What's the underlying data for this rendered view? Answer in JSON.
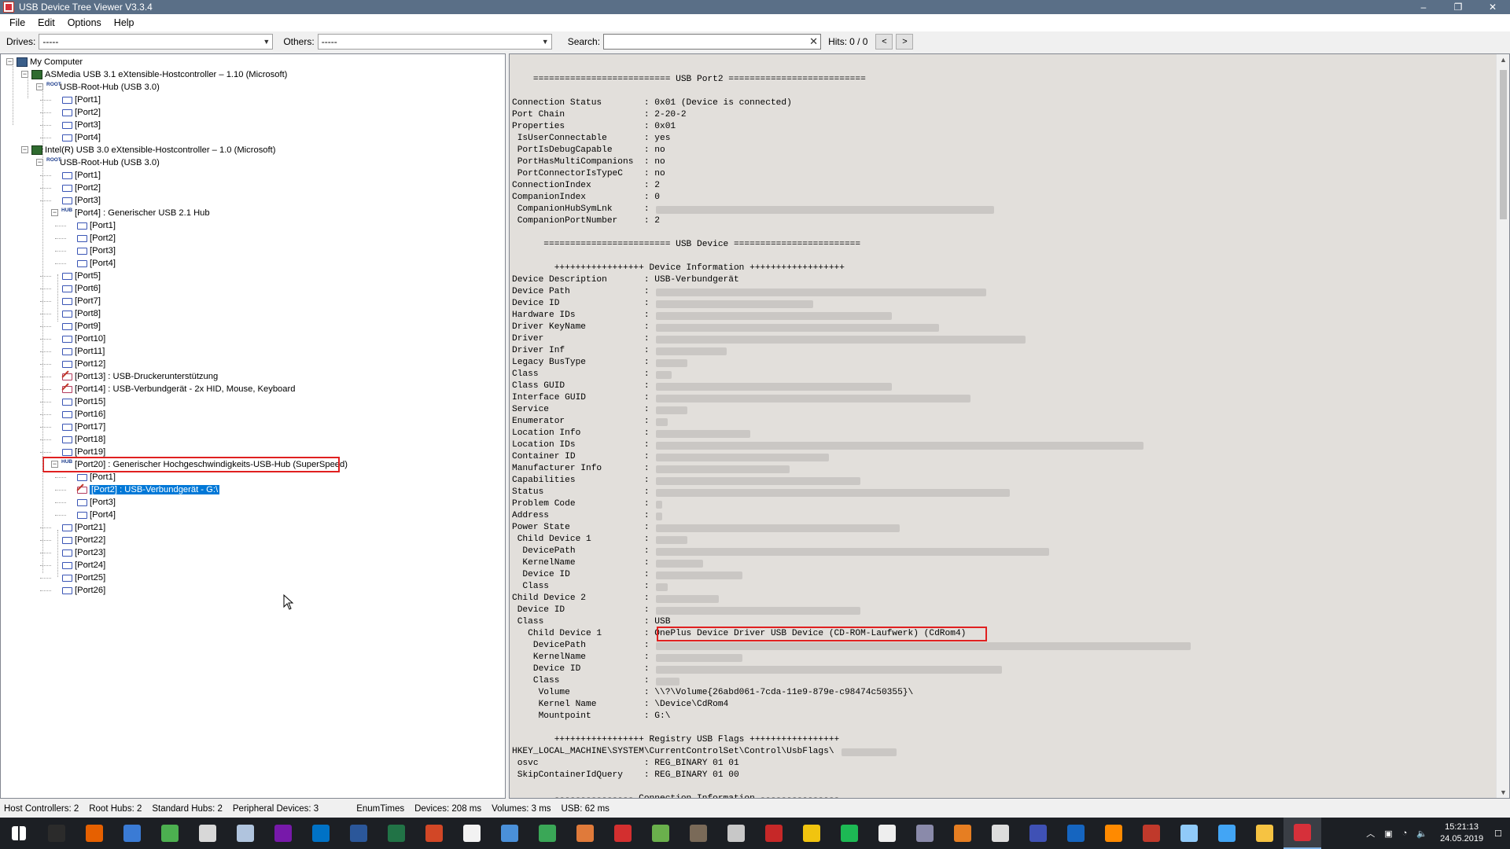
{
  "window": {
    "title": "USB Device Tree Viewer V3.3.4",
    "min": "–",
    "max": "❐",
    "close": "✕"
  },
  "menu": [
    "File",
    "Edit",
    "Options",
    "Help"
  ],
  "toolbar": {
    "drives_label": "Drives:",
    "drives_value": "-----",
    "others_label": "Others:",
    "others_value": "-----",
    "search_label": "Search:",
    "search_value": "",
    "hits_label": "Hits:",
    "hits_value": "0 / 0",
    "prev": "<",
    "next": ">"
  },
  "tree": [
    {
      "label": "My Computer",
      "level": 0,
      "icon": "computer-icon",
      "exp": "minus"
    },
    {
      "label": "ASMedia USB 3.1 eXtensible-Hostcontroller – 1.10 (Microsoft)",
      "level": 1,
      "icon": "controller-icon",
      "exp": "minus"
    },
    {
      "label": "USB-Root-Hub (USB 3.0)",
      "level": 2,
      "icon": "root-hub-icon",
      "exp": "minus"
    },
    {
      "label": "[Port1]",
      "level": 3,
      "icon": "usb-port-icon"
    },
    {
      "label": "[Port2]",
      "level": 3,
      "icon": "usb-port-icon"
    },
    {
      "label": "[Port3]",
      "level": 3,
      "icon": "usb-port-icon"
    },
    {
      "label": "[Port4]",
      "level": 3,
      "icon": "usb-port-icon"
    },
    {
      "label": "Intel(R) USB 3.0 eXtensible-Hostcontroller – 1.0 (Microsoft)",
      "level": 1,
      "icon": "controller-icon",
      "exp": "minus"
    },
    {
      "label": "USB-Root-Hub (USB 3.0)",
      "level": 2,
      "icon": "root-hub-icon",
      "exp": "minus"
    },
    {
      "label": "[Port1]",
      "level": 3,
      "icon": "usb-port-icon"
    },
    {
      "label": "[Port2]",
      "level": 3,
      "icon": "usb-port-icon"
    },
    {
      "label": "[Port3]",
      "level": 3,
      "icon": "usb-port-icon"
    },
    {
      "label": "[Port4] : Generischer USB 2.1 Hub",
      "level": 3,
      "icon": "hub-icon",
      "exp": "minus"
    },
    {
      "label": "[Port1]",
      "level": 4,
      "icon": "usb-port-icon"
    },
    {
      "label": "[Port2]",
      "level": 4,
      "icon": "usb-port-icon"
    },
    {
      "label": "[Port3]",
      "level": 4,
      "icon": "usb-port-icon"
    },
    {
      "label": "[Port4]",
      "level": 4,
      "icon": "usb-port-icon"
    },
    {
      "label": "[Port5]",
      "level": 3,
      "icon": "usb-port-icon"
    },
    {
      "label": "[Port6]",
      "level": 3,
      "icon": "usb-port-icon"
    },
    {
      "label": "[Port7]",
      "level": 3,
      "icon": "usb-port-icon"
    },
    {
      "label": "[Port8]",
      "level": 3,
      "icon": "usb-port-icon"
    },
    {
      "label": "[Port9]",
      "level": 3,
      "icon": "usb-port-icon"
    },
    {
      "label": "[Port10]",
      "level": 3,
      "icon": "usb-port-icon"
    },
    {
      "label": "[Port11]",
      "level": 3,
      "icon": "usb-port-icon"
    },
    {
      "label": "[Port12]",
      "level": 3,
      "icon": "usb-port-icon"
    },
    {
      "label": "[Port13] : USB-Druckerunterstützung",
      "level": 3,
      "icon": "usb-device-icon"
    },
    {
      "label": "[Port14] : USB-Verbundgerät - 2x HID, Mouse, Keyboard",
      "level": 3,
      "icon": "usb-device-icon"
    },
    {
      "label": "[Port15]",
      "level": 3,
      "icon": "usb-port-icon"
    },
    {
      "label": "[Port16]",
      "level": 3,
      "icon": "usb-port-icon"
    },
    {
      "label": "[Port17]",
      "level": 3,
      "icon": "usb-port-icon"
    },
    {
      "label": "[Port18]",
      "level": 3,
      "icon": "usb-port-icon"
    },
    {
      "label": "[Port19]",
      "level": 3,
      "icon": "usb-port-icon"
    },
    {
      "label": "[Port20] : Generischer Hochgeschwindigkeits-USB-Hub (SuperSpeed)",
      "level": 3,
      "icon": "hub-icon",
      "exp": "minus",
      "boxed": true
    },
    {
      "label": "[Port1]",
      "level": 4,
      "icon": "usb-port-icon"
    },
    {
      "label": "[Port2] : USB-Verbundgerät - G:\\",
      "level": 4,
      "icon": "usb-device-icon",
      "selected": true
    },
    {
      "label": "[Port3]",
      "level": 4,
      "icon": "usb-port-icon"
    },
    {
      "label": "[Port4]",
      "level": 4,
      "icon": "usb-port-icon"
    },
    {
      "label": "[Port21]",
      "level": 3,
      "icon": "usb-port-icon"
    },
    {
      "label": "[Port22]",
      "level": 3,
      "icon": "usb-port-icon"
    },
    {
      "label": "[Port23]",
      "level": 3,
      "icon": "usb-port-icon"
    },
    {
      "label": "[Port24]",
      "level": 3,
      "icon": "usb-port-icon"
    },
    {
      "label": "[Port25]",
      "level": 3,
      "icon": "usb-port-icon"
    },
    {
      "label": "[Port26]",
      "level": 3,
      "icon": "usb-port-icon"
    }
  ],
  "details": [
    {
      "t": "",
      "blur": 0
    },
    {
      "t": "    ========================== USB Port2 ==========================",
      "blur": 0
    },
    {
      "t": "",
      "blur": 0
    },
    {
      "t": "Connection Status        : 0x01 (Device is connected)",
      "blur": 0
    },
    {
      "t": "Port Chain               : 2-20-2",
      "blur": 0
    },
    {
      "t": "Properties               : 0x01",
      "blur": 0
    },
    {
      "t": " IsUserConnectable       : yes",
      "blur": 0
    },
    {
      "t": " PortIsDebugCapable      : no",
      "blur": 0
    },
    {
      "t": " PortHasMultiCompanions  : no",
      "blur": 0
    },
    {
      "t": " PortConnectorIsTypeC    : no",
      "blur": 0
    },
    {
      "t": "ConnectionIndex          : 2",
      "blur": 0
    },
    {
      "t": "CompanionIndex           : 0",
      "blur": 0
    },
    {
      "t": " CompanionHubSymLnk      :",
      "blur": 430
    },
    {
      "t": " CompanionPortNumber     : 2",
      "blur": 0
    },
    {
      "t": "",
      "blur": 0
    },
    {
      "t": "      ======================== USB Device ========================",
      "blur": 0
    },
    {
      "t": "",
      "blur": 0
    },
    {
      "t": "        +++++++++++++++++ Device Information ++++++++++++++++++",
      "blur": 0
    },
    {
      "t": "Device Description       : USB-Verbundgerät",
      "blur": 0
    },
    {
      "t": "Device Path              :",
      "blur": 420
    },
    {
      "t": "Device ID                :",
      "blur": 200
    },
    {
      "t": "Hardware IDs             :",
      "blur": 300
    },
    {
      "t": "Driver KeyName           :",
      "blur": 360
    },
    {
      "t": "Driver                   :",
      "blur": 470
    },
    {
      "t": "Driver Inf               :",
      "blur": 90
    },
    {
      "t": "Legacy BusType           :",
      "blur": 40
    },
    {
      "t": "Class                    :",
      "blur": 20
    },
    {
      "t": "Class GUID               :",
      "blur": 300
    },
    {
      "t": "Interface GUID           :",
      "blur": 400
    },
    {
      "t": "Service                  :",
      "blur": 40
    },
    {
      "t": "Enumerator               :",
      "blur": 15
    },
    {
      "t": "Location Info            :",
      "blur": 120
    },
    {
      "t": "Location IDs             :",
      "blur": 620
    },
    {
      "t": "Container ID             :",
      "blur": 220
    },
    {
      "t": "Manufacturer Info        :",
      "blur": 170
    },
    {
      "t": "Capabilities             :",
      "blur": 260
    },
    {
      "t": "Status                   :",
      "blur": 450
    },
    {
      "t": "Problem Code             :",
      "blur": 8
    },
    {
      "t": "Address                  :",
      "blur": 8
    },
    {
      "t": "Power State              :",
      "blur": 310
    },
    {
      "t": " Child Device 1          :",
      "blur": 40
    },
    {
      "t": "  DevicePath             :",
      "blur": 500
    },
    {
      "t": "  KernelName             :",
      "blur": 60
    },
    {
      "t": "  Device ID              :",
      "blur": 110
    },
    {
      "t": "  Class                  :",
      "blur": 15
    },
    {
      "t": "Child Device 2           :",
      "blur": 80
    },
    {
      "t": " Device ID               :",
      "blur": 260
    },
    {
      "t": " Class                   : USB",
      "blur": 0
    },
    {
      "t": "   Child Device 1        : OnePlus Device Driver USB Device (CD-ROM-Laufwerk) (CdRom4)",
      "blur": 0,
      "boxed": true
    },
    {
      "t": "    DevicePath           :",
      "blur": 680
    },
    {
      "t": "    KernelName           :",
      "blur": 110
    },
    {
      "t": "    Device ID            :",
      "blur": 440
    },
    {
      "t": "    Class                :",
      "blur": 30
    },
    {
      "t": "     Volume              : \\\\?\\Volume{26abd061-7cda-11e9-879e-c98474c50355}\\",
      "blur": 0
    },
    {
      "t": "     Kernel Name         : \\Device\\CdRom4",
      "blur": 0
    },
    {
      "t": "     Mountpoint          : G:\\",
      "blur": 0
    },
    {
      "t": "",
      "blur": 0
    },
    {
      "t": "        +++++++++++++++++ Registry USB Flags +++++++++++++++++",
      "blur": 0
    },
    {
      "t": "HKEY_LOCAL_MACHINE\\SYSTEM\\CurrentControlSet\\Control\\UsbFlags\\",
      "blur": 70
    },
    {
      "t": " osvc                    : REG_BINARY 01 01",
      "blur": 0
    },
    {
      "t": " SkipContainerIdQuery    : REG_BINARY 01 00",
      "blur": 0
    },
    {
      "t": "",
      "blur": 0
    },
    {
      "t": "        --------------- Connection Information ---------------",
      "blur": 0
    }
  ],
  "status": {
    "host_controllers": "Host Controllers: 2",
    "root_hubs": "Root Hubs: 2",
    "standard_hubs": "Standard Hubs: 2",
    "peripheral": "Peripheral Devices: 3",
    "enum_label": "EnumTimes",
    "devices": "Devices: 208 ms",
    "volumes": "Volumes: 3 ms",
    "usb": "USB: 62 ms"
  },
  "taskbar": {
    "apps": [
      {
        "name": "start-icon",
        "color": "#ffffff"
      },
      {
        "name": "terminal-icon",
        "color": "#2b2b2b"
      },
      {
        "name": "firefox-icon",
        "color": "#e66000"
      },
      {
        "name": "thunderbird-icon",
        "color": "#3a7bd5"
      },
      {
        "name": "chrome-icon",
        "color": "#4caf50"
      },
      {
        "name": "notepad-icon",
        "color": "#d8d8d8"
      },
      {
        "name": "calculator-icon",
        "color": "#b0c4de"
      },
      {
        "name": "onenote-icon",
        "color": "#7719aa"
      },
      {
        "name": "outlook-icon",
        "color": "#0072c6"
      },
      {
        "name": "word-icon",
        "color": "#2b579a"
      },
      {
        "name": "excel-icon",
        "color": "#217346"
      },
      {
        "name": "powerpoint-icon",
        "color": "#d24726"
      },
      {
        "name": "file-icon",
        "color": "#f2f2f2"
      },
      {
        "name": "document-icon",
        "color": "#4a90d9"
      },
      {
        "name": "spreadsheet-icon",
        "color": "#3aa757"
      },
      {
        "name": "presentation-icon",
        "color": "#e07a3a"
      },
      {
        "name": "pdf-icon",
        "color": "#d32f2f"
      },
      {
        "name": "notes-icon",
        "color": "#6ab04c"
      },
      {
        "name": "gimp-icon",
        "color": "#7a6a58"
      },
      {
        "name": "shield-icon",
        "color": "#c8c8c8"
      },
      {
        "name": "media-icon",
        "color": "#c62828"
      },
      {
        "name": "paint-icon",
        "color": "#f1c40f"
      },
      {
        "name": "spotify-icon",
        "color": "#1db954"
      },
      {
        "name": "soundcloud-icon",
        "color": "#eeeeee"
      },
      {
        "name": "network-icon",
        "color": "#8a8aaa"
      },
      {
        "name": "check-icon",
        "color": "#e67e22"
      },
      {
        "name": "eac-icon",
        "color": "#dddddd"
      },
      {
        "name": "disk-icon",
        "color": "#3f51b5"
      },
      {
        "name": "film-icon",
        "color": "#1565c0"
      },
      {
        "name": "vs-icon",
        "color": "#ff8a00"
      },
      {
        "name": "tool-icon",
        "color": "#c0392b"
      },
      {
        "name": "box-icon",
        "color": "#90caf9"
      },
      {
        "name": "window-icon",
        "color": "#42a5f5"
      },
      {
        "name": "folder-icon",
        "color": "#f6c342"
      },
      {
        "name": "usb-viewer-icon",
        "color": "#d6303a"
      }
    ],
    "time": "15:21:13",
    "date": "24.05.2019"
  }
}
